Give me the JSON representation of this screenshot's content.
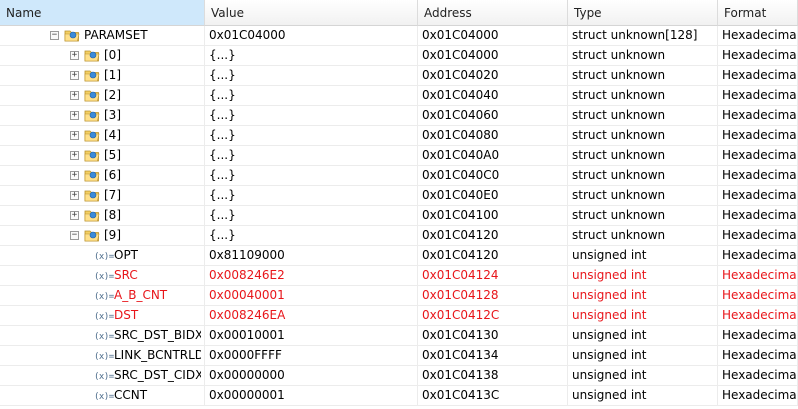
{
  "columns": [
    {
      "label": "Name",
      "selected": true
    },
    {
      "label": "Value"
    },
    {
      "label": "Address"
    },
    {
      "label": "Type"
    },
    {
      "label": "Format"
    }
  ],
  "colors": {
    "changed": "#e8151a",
    "header_selected": "#cfe8fb"
  },
  "rows": [
    {
      "name": "PARAMSET",
      "value": "0x01C04000",
      "address": "0x01C04000",
      "type": "struct unknown[128]",
      "format": "Hexadecimal",
      "depth": 0,
      "kind": "folder",
      "toggle": "minus"
    },
    {
      "name": "[0]",
      "value": "{...}",
      "address": "0x01C04000",
      "type": "struct unknown",
      "format": "Hexadecimal",
      "depth": 1,
      "kind": "folder",
      "toggle": "plus"
    },
    {
      "name": "[1]",
      "value": "{...}",
      "address": "0x01C04020",
      "type": "struct unknown",
      "format": "Hexadecimal",
      "depth": 1,
      "kind": "folder",
      "toggle": "plus"
    },
    {
      "name": "[2]",
      "value": "{...}",
      "address": "0x01C04040",
      "type": "struct unknown",
      "format": "Hexadecimal",
      "depth": 1,
      "kind": "folder",
      "toggle": "plus"
    },
    {
      "name": "[3]",
      "value": "{...}",
      "address": "0x01C04060",
      "type": "struct unknown",
      "format": "Hexadecimal",
      "depth": 1,
      "kind": "folder",
      "toggle": "plus"
    },
    {
      "name": "[4]",
      "value": "{...}",
      "address": "0x01C04080",
      "type": "struct unknown",
      "format": "Hexadecimal",
      "depth": 1,
      "kind": "folder",
      "toggle": "plus"
    },
    {
      "name": "[5]",
      "value": "{...}",
      "address": "0x01C040A0",
      "type": "struct unknown",
      "format": "Hexadecimal",
      "depth": 1,
      "kind": "folder",
      "toggle": "plus"
    },
    {
      "name": "[6]",
      "value": "{...}",
      "address": "0x01C040C0",
      "type": "struct unknown",
      "format": "Hexadecimal",
      "depth": 1,
      "kind": "folder",
      "toggle": "plus"
    },
    {
      "name": "[7]",
      "value": "{...}",
      "address": "0x01C040E0",
      "type": "struct unknown",
      "format": "Hexadecimal",
      "depth": 1,
      "kind": "folder",
      "toggle": "plus"
    },
    {
      "name": "[8]",
      "value": "{...}",
      "address": "0x01C04100",
      "type": "struct unknown",
      "format": "Hexadecimal",
      "depth": 1,
      "kind": "folder",
      "toggle": "plus"
    },
    {
      "name": "[9]",
      "value": "{...}",
      "address": "0x01C04120",
      "type": "struct unknown",
      "format": "Hexadecimal",
      "depth": 1,
      "kind": "folder",
      "toggle": "minus"
    },
    {
      "name": "OPT",
      "value": "0x81109000",
      "address": "0x01C04120",
      "type": "unsigned int",
      "format": "Hexadecimal",
      "depth": 2,
      "kind": "var"
    },
    {
      "name": "SRC",
      "value": "0x008246E2",
      "address": "0x01C04124",
      "type": "unsigned int",
      "format": "Hexadecimal",
      "depth": 2,
      "kind": "var",
      "changed": true
    },
    {
      "name": "A_B_CNT",
      "value": "0x00040001",
      "address": "0x01C04128",
      "type": "unsigned int",
      "format": "Hexadecimal",
      "depth": 2,
      "kind": "var",
      "changed": true
    },
    {
      "name": "DST",
      "value": "0x008246EA",
      "address": "0x01C0412C",
      "type": "unsigned int",
      "format": "Hexadecimal",
      "depth": 2,
      "kind": "var",
      "changed": true
    },
    {
      "name": "SRC_DST_BIDX",
      "value": "0x00010001",
      "address": "0x01C04130",
      "type": "unsigned int",
      "format": "Hexadecimal",
      "depth": 2,
      "kind": "var"
    },
    {
      "name": "LINK_BCNTRLD",
      "value": "0x0000FFFF",
      "address": "0x01C04134",
      "type": "unsigned int",
      "format": "Hexadecimal",
      "depth": 2,
      "kind": "var"
    },
    {
      "name": "SRC_DST_CIDX",
      "value": "0x00000000",
      "address": "0x01C04138",
      "type": "unsigned int",
      "format": "Hexadecimal",
      "depth": 2,
      "kind": "var"
    },
    {
      "name": "CCNT",
      "value": "0x00000001",
      "address": "0x01C0413C",
      "type": "unsigned int",
      "format": "Hexadecimal",
      "depth": 2,
      "kind": "var"
    }
  ]
}
